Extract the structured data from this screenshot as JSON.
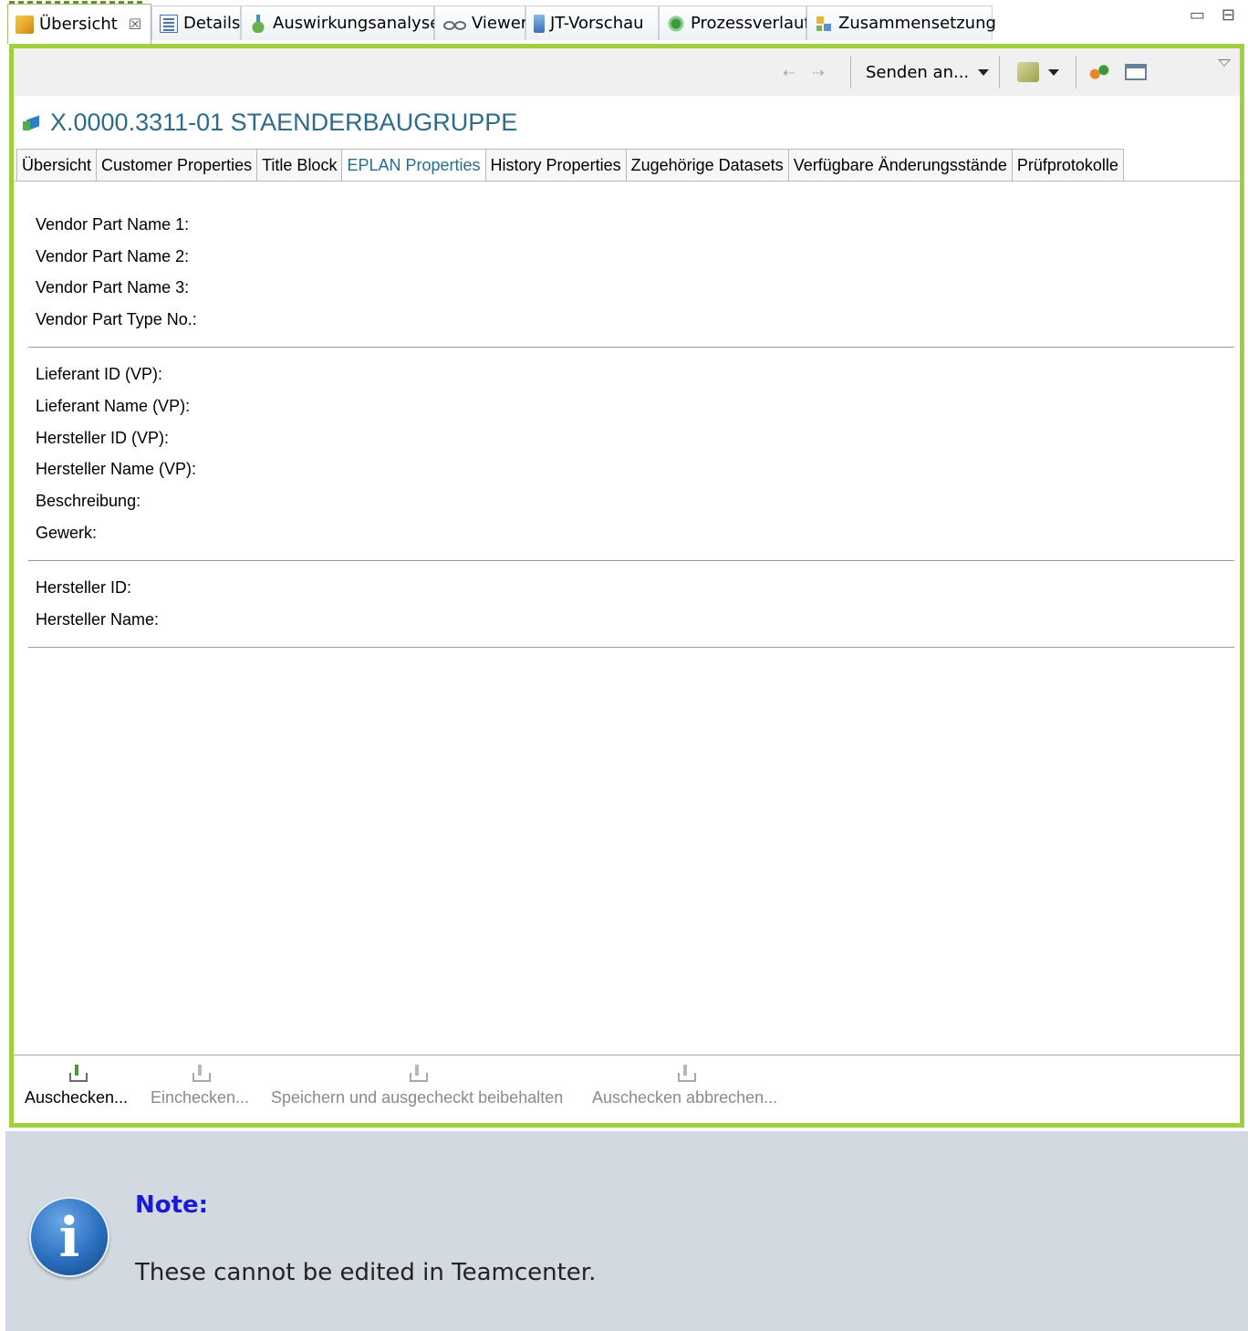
{
  "view_tabs": [
    {
      "label": "Übersicht",
      "icon": "folder-icon",
      "active": true
    },
    {
      "label": "Details",
      "icon": "details-icon"
    },
    {
      "label": "Auswirkungsanalyse",
      "icon": "impact-analysis-icon"
    },
    {
      "label": "Viewer",
      "icon": "glasses-icon"
    },
    {
      "label": "JT-Vorschau",
      "icon": "jt-preview-icon"
    },
    {
      "label": "Prozessverlauf",
      "icon": "process-history-icon"
    },
    {
      "label": "Zusammensetzung",
      "icon": "composition-icon"
    }
  ],
  "view_tab_close": "☒",
  "window_controls": {
    "minimize": "▭",
    "maximize": "⊟"
  },
  "toolbar": {
    "back": "⇠",
    "forward": "⇢",
    "send_to_label": "Senden an..."
  },
  "object_title": "X.0000.3311-01 STAENDERBAUGRUPPE",
  "sub_tabs": [
    {
      "label": "Übersicht"
    },
    {
      "label": "Customer Properties"
    },
    {
      "label": "Title Block"
    },
    {
      "label": "EPLAN Properties",
      "active": true
    },
    {
      "label": "History Properties"
    },
    {
      "label": "Zugehörige Datasets"
    },
    {
      "label": "Verfügbare Änderungsstände"
    },
    {
      "label": "Prüfprotokolle"
    }
  ],
  "property_groups": [
    [
      "Vendor Part Name 1:",
      "Vendor Part Name 2:",
      "Vendor Part Name 3:",
      "Vendor Part Type No.:"
    ],
    [
      "Lieferant ID (VP):",
      "Lieferant Name (VP):",
      "Hersteller ID (VP):",
      "Hersteller Name (VP):",
      "Beschreibung:",
      "Gewerk:"
    ],
    [
      "Hersteller ID:",
      "Hersteller Name:"
    ]
  ],
  "commands": [
    {
      "label": "Auschecken...",
      "enabled": true
    },
    {
      "label": "Einchecken...",
      "enabled": false
    },
    {
      "label": "Speichern und ausgecheckt beibehalten",
      "enabled": false
    },
    {
      "label": "Auschecken abbrechen...",
      "enabled": false
    }
  ],
  "note": {
    "title": "Note:",
    "text": "These cannot be edited in Teamcenter.",
    "icon_glyph": "i"
  },
  "colors": {
    "frame_accent": "#9fd13f",
    "title_blue": "#2d6b8a",
    "note_bg": "#d3d9e1",
    "note_title": "#1b1bd6"
  }
}
